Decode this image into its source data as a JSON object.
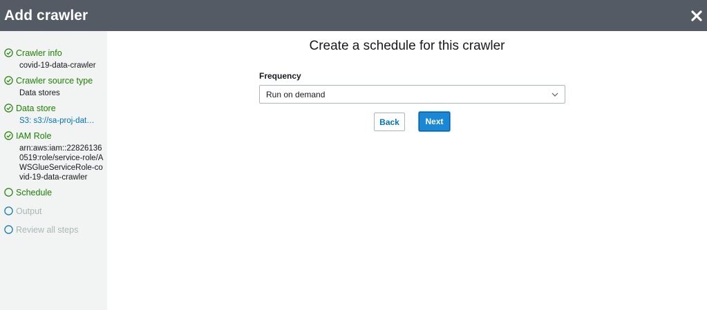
{
  "header": {
    "title": "Add crawler"
  },
  "steps": [
    {
      "label": "Crawler info",
      "state": "done",
      "detail": "covid-19-data-crawler"
    },
    {
      "label": "Crawler source type",
      "state": "done",
      "detail": "Data stores"
    },
    {
      "label": "Data store",
      "state": "done",
      "detail": "S3: s3://sa-proj-dat…"
    },
    {
      "label": "IAM Role",
      "state": "done",
      "detail": "arn:aws:iam::228261360519:role/service-role/AWSGlueServiceRole-covid-19-data-crawler"
    },
    {
      "label": "Schedule",
      "state": "current"
    },
    {
      "label": "Output",
      "state": "future"
    },
    {
      "label": "Review all steps",
      "state": "future"
    }
  ],
  "main": {
    "title": "Create a schedule for this crawler",
    "frequency_label": "Frequency",
    "frequency_value": "Run on demand",
    "back_label": "Back",
    "next_label": "Next"
  },
  "colors": {
    "header": "#545b64",
    "sidebar": "#f2f3f3",
    "done": "#1d8102",
    "future": "#aab7b8",
    "link": "#0073bb",
    "primary": "#1a88d4"
  },
  "icons": {
    "close": "close-icon",
    "done": "check-circle-icon",
    "current": "circle-icon",
    "future": "circle-icon",
    "select": "chevron-down-icon"
  }
}
